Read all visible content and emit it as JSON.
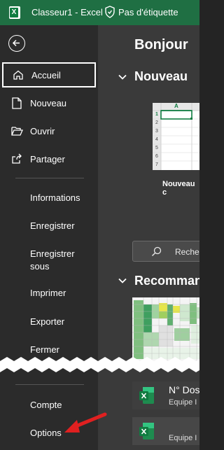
{
  "titlebar": {
    "app_icon": "excel-icon",
    "title": "Classeur1  -  Excel",
    "sensitivity_label": "Pas d'étiquette"
  },
  "sidebar": {
    "back_icon": "back-arrow-icon",
    "items": [
      {
        "label": "Accueil",
        "icon": "home-icon",
        "active": true
      },
      {
        "label": "Nouveau",
        "icon": "new-file-icon"
      },
      {
        "label": "Ouvrir",
        "icon": "open-folder-icon"
      },
      {
        "label": "Partager",
        "icon": "share-icon"
      },
      {
        "label": "Informations"
      },
      {
        "label": "Enregistrer"
      },
      {
        "label": "Enregistrer\nsous"
      },
      {
        "label": "Imprimer"
      },
      {
        "label": "Exporter"
      },
      {
        "label": "Fermer"
      },
      {
        "label": "Compte"
      },
      {
        "label": "Options"
      }
    ]
  },
  "main": {
    "greeting": "Bonjour",
    "new_section": "Nouveau",
    "new_template_label": "Nouveau c",
    "thumb_col": "A",
    "thumb_rows": [
      "1",
      "2",
      "3",
      "4",
      "5",
      "6",
      "7"
    ],
    "search_placeholder": "Recherch",
    "recommended_section": "Recommand",
    "recent_files": [
      {
        "name": "N° Dos",
        "location": "Equipe I"
      },
      {
        "name": "",
        "location": "Equipe I"
      }
    ]
  },
  "colors": {
    "excel_green": "#107c41",
    "annotation_arrow": "#e02020"
  }
}
